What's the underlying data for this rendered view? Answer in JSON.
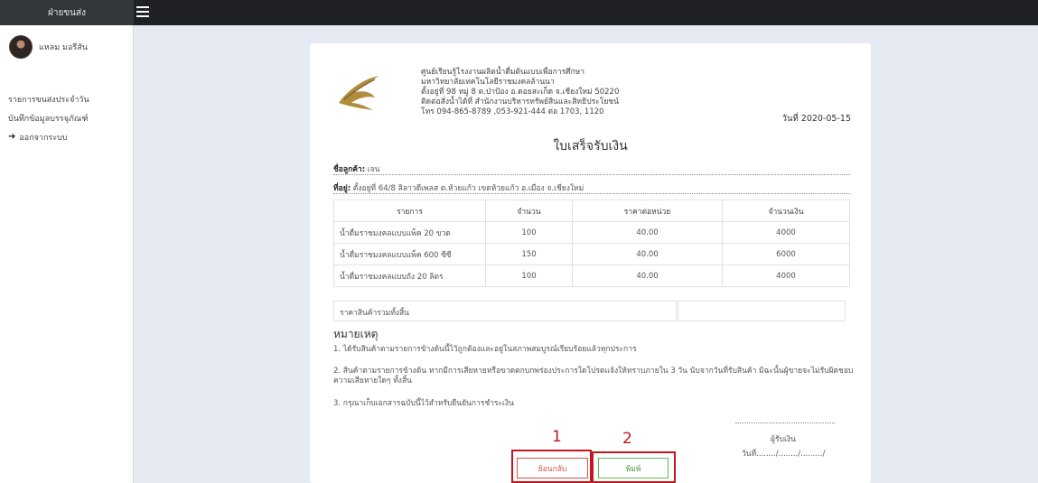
{
  "topbar": {
    "brand": "ฝ่ายขนส่ง"
  },
  "sidebar": {
    "user_name": "แหลม มอรีสัน",
    "items": [
      {
        "label": "รายการขนส่งประจำวัน"
      },
      {
        "label": "บันทึกข้อมูลบรรจุภัณฑ์"
      },
      {
        "label": "ออกจากระบบ",
        "icon": "logout-icon"
      }
    ]
  },
  "receipt": {
    "company_lines": [
      "ศูนย์เรียนรู้โรงงานผลิตน้ำดื่มต้นแบบเพื่อการศึกษา",
      "มหาวิทยาลัยเทคโนโลยีราชมงคลล้านนา",
      "ตั้งอยู่ที่ 98 หมู่ 8 ต.ป่าป้อง อ.ดอยสะเก็ด จ.เชียงใหม่ 50220",
      "ติดต่อสั่งน้ำได้ที่ สำนักงานบริหารทรัพย์สินและสิทธิประโยชน์",
      "โทร 094-865-8789 ,053-921-444 ต่อ 1703, 1120"
    ],
    "date_label": "วันที่ 2020-05-15",
    "title": "ใบเสร็จรับเงิน",
    "customer_label": "ชื่อลูกค้า:",
    "customer_value": "เจน",
    "address_label": "ที่อยู่:",
    "address_value": "ตั้งอยู่ที่ 64/8 ลิลาวดีเพลส ต.ห้วยแก้ว เขตห้วยแก้ว อ.เมือง จ.เชียงใหม่",
    "table": {
      "headers": [
        "รายการ",
        "จำนวน",
        "ราคาต่อหน่วย",
        "จำนวนเงิน"
      ],
      "rows": [
        [
          "น้ำดื่มราชมงคลแบบแพ็ค 20 ขวด",
          "100",
          "40.00",
          "4000"
        ],
        [
          "น้ำดื่มราชมงคลแบบแพ็ค 600 ซีซี",
          "150",
          "40.00",
          "6000"
        ],
        [
          "น้ำดื่มราชมงคลแบบถัง 20 ลิตร",
          "100",
          "40.00",
          "4000"
        ]
      ]
    },
    "total_label": "ราคาสินค้ารวมทั้งสิ้น",
    "total_value": "",
    "notes_heading": "หมายเหตุ",
    "notes": [
      "1. ได้รับสินค้าตามรายการข้างต้นนี้ไว้ถูกต้องและอยู่ในสภาพสมบูรณ์เรียบร้อยแล้วทุกประการ",
      "2. สินค้าตามรายการข้างต้น หากมีการเสียหายหรือขาดตกบกพร่องประการใดโปรดแจ้งให้ทราบภายใน 3 วัน นับจากวันที่รับสินค้า มิฉะนั้นผู้ขายจะไม่รับผิดชอบความเสียหายใดๆ ทั้งสิ้น",
      "3. กรุณาเก็บเอกสารฉบับนี้ไว้สำหรับยืนยันการชำระเงิน"
    ],
    "signature_label": "ผู้รับเงิน",
    "signature_date": "วันที่......../......../........./",
    "buttons": {
      "back": "ย้อนกลับ",
      "print": "พิมพ์"
    }
  },
  "annotations": {
    "label_1": "1",
    "label_2": "2",
    "color": "#c4161c"
  }
}
